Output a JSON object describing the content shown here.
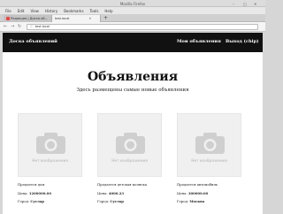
{
  "window": {
    "title": "Mozilla Firefox"
  },
  "menu": [
    "File",
    "Edit",
    "View",
    "History",
    "Bookmarks",
    "Tools",
    "Help"
  ],
  "tabs": [
    {
      "label": "Редакция | Доска об...",
      "active": false
    },
    {
      "label": "test.local",
      "active": true
    }
  ],
  "url": "test.local",
  "site": {
    "brand": "Доска объявлений",
    "nav_mine": "Мои объявления",
    "nav_logout": "Выход (chip)",
    "heading": "Объявления",
    "lead": "Здесь размещены самые новые объявления",
    "no_image": "Нет изображения",
    "price_label": "Цена:",
    "city_label": "Город:"
  },
  "listings": [
    {
      "title": "Продается дом",
      "price": "1200000.00",
      "city": "Суслар"
    },
    {
      "title": "Продается детская коляска",
      "price": "4000.23",
      "city": "Суслар"
    },
    {
      "title": "Продается автомобиль",
      "price": "300000.00",
      "city": "Москва"
    }
  ]
}
